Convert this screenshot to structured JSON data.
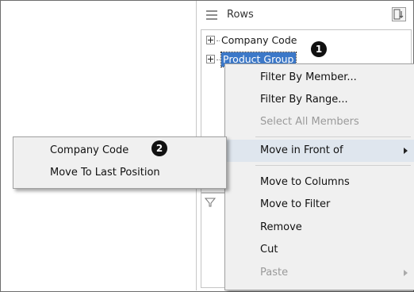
{
  "rows_panel": {
    "title": "Rows",
    "icon": "rows-icon",
    "items": [
      {
        "label": "Company Code"
      },
      {
        "label": "Product Group"
      }
    ]
  },
  "context_menu": {
    "items": [
      {
        "label": "Filter By Member..."
      },
      {
        "label": "Filter By Range..."
      },
      {
        "label": "Select All Members"
      },
      {
        "label": "Move in Front of"
      },
      {
        "label": "Move to Columns"
      },
      {
        "label": "Move to Filter"
      },
      {
        "label": "Remove"
      },
      {
        "label": "Cut"
      },
      {
        "label": "Paste"
      }
    ]
  },
  "submenu": {
    "items": [
      {
        "label": "Company Code"
      },
      {
        "label": "Move To Last Position"
      }
    ]
  },
  "callouts": [
    "1",
    "2"
  ],
  "colors": {
    "selection": "#3c78c8",
    "menu_bg": "#f0f0f0",
    "highlight": "#dfe6ee"
  }
}
